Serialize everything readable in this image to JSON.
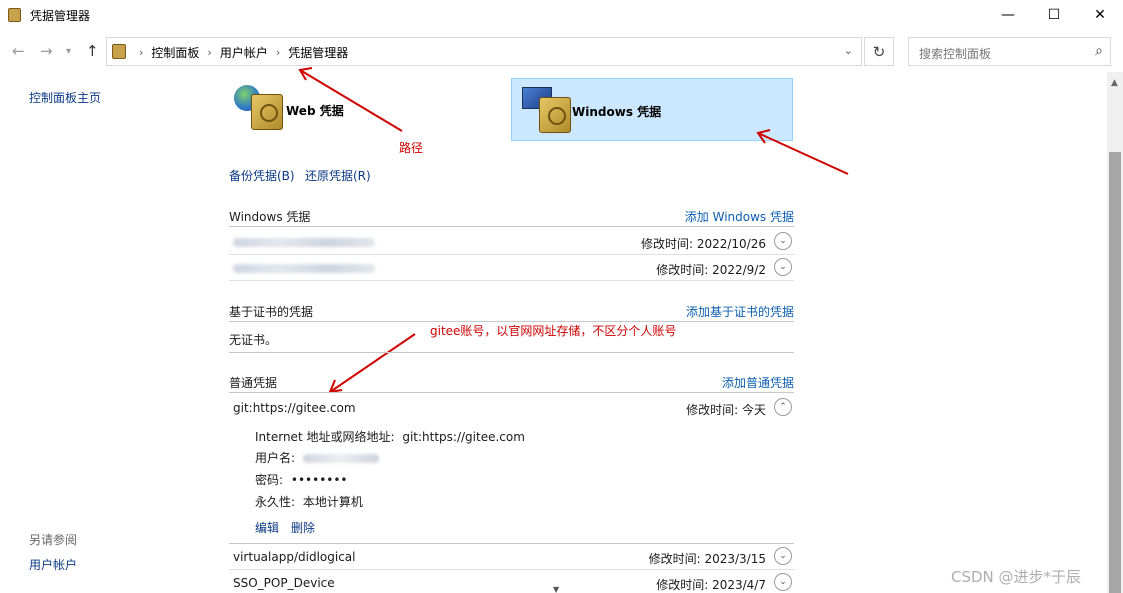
{
  "window": {
    "title": "凭据管理器",
    "minimize": "—",
    "maximize": "☐",
    "close": "✕"
  },
  "nav": {
    "breadcrumbs": [
      "控制面板",
      "用户帐户",
      "凭据管理器"
    ],
    "search_placeholder": "搜索控制面板"
  },
  "sidebar": {
    "home": "控制面板主页",
    "see_also": "另请参阅",
    "user_accounts": "用户帐户"
  },
  "tiles": {
    "web": "Web 凭据",
    "windows": "Windows 凭据"
  },
  "annotations": {
    "path": "路径",
    "gitee": "gitee账号，以官网网址存储，不区分个人账号"
  },
  "links": {
    "backup": "备份凭据(B)",
    "restore": "还原凭据(R)"
  },
  "sections": {
    "windows": {
      "title": "Windows 凭据",
      "add": "添加 Windows 凭据",
      "rows": [
        {
          "modified": "修改时间:  2022/10/26"
        },
        {
          "modified": "修改时间:  2022/9/2"
        }
      ]
    },
    "cert": {
      "title": "基于证书的凭据",
      "add": "添加基于证书的凭据",
      "empty": "无证书。"
    },
    "generic": {
      "title": "普通凭据",
      "add": "添加普通凭据",
      "expanded": {
        "name": "git:https://gitee.com",
        "modified": "修改时间:  今天",
        "address_label": "Internet 地址或网络地址:",
        "address_value": "git:https://gitee.com",
        "user_label": "用户名:",
        "password_label": "密码:",
        "password_value": "••••••••",
        "persistence_label": "永久性:",
        "persistence_value": "本地计算机",
        "edit": "编辑",
        "delete": "删除"
      },
      "rows": [
        {
          "name": "virtualapp/didlogical",
          "modified": "修改时间:  2023/3/15"
        },
        {
          "name": "SSO_POP_Device",
          "modified": "修改时间:  2023/4/7"
        }
      ]
    }
  },
  "watermark": "CSDN @进步*于辰",
  "accent_colors": {
    "selected_tile": "#cce8ff",
    "link": "#0d5fb0",
    "annotation": "#d00000"
  }
}
